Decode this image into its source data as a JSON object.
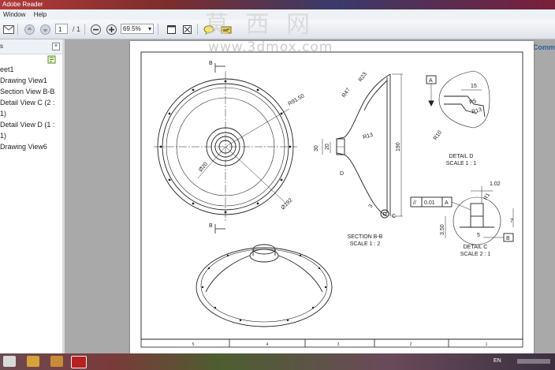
{
  "app": {
    "title": "Adobe Reader"
  },
  "menu": {
    "items": [
      "Window",
      "Help"
    ]
  },
  "toolbar": {
    "page_current": "1",
    "page_total": "/ 1",
    "zoom": "69.5%",
    "comment_label": "Comm"
  },
  "sidebar": {
    "title_fragment": "s",
    "items": [
      "eet1",
      "Drawing View1",
      "Section View B-B",
      "Detail View C (2 :",
      "1)",
      "Detail View D (1 :",
      "1)",
      "Drawing View6"
    ]
  },
  "watermark": {
    "chinese": "莫 西 网",
    "url": "www.3dmox.com"
  },
  "drawing": {
    "section_label_b": "B",
    "dim_r91": "R91.50",
    "dim_d20": "Ø20",
    "dim_d192": "Ø192",
    "dim_r23": "R23",
    "dim_r47": "R47",
    "dim_30": "30",
    "dim_20": "20",
    "dim_r13": "R13",
    "dim_190": "190",
    "dim_3": "3",
    "label_d": "D",
    "label_c": "C",
    "section_title": "SECTION B-B",
    "section_scale": "SCALE 1 : 2",
    "detail_d_a": "A",
    "detail_d_15": "15",
    "detail_d_r5": "R5",
    "detail_d_r13": "R13",
    "detail_d_r10": "R10",
    "detail_d_title": "DETAIL D",
    "detail_d_scale": "SCALE 1 : 1",
    "detail_c_102": "1.02",
    "detail_c_r1": "R1",
    "detail_c_tol_sym": "//",
    "detail_c_tol": "0.01",
    "detail_c_tol_ref": "A",
    "detail_c_350": "3.50",
    "detail_c_7": "7",
    "detail_c_5": "5",
    "detail_c_b": "B",
    "detail_c_title": "DETAIL C",
    "detail_c_scale": "SCALE 2 : 1",
    "zones": [
      "5",
      "4",
      "3",
      "2",
      "1"
    ]
  },
  "taskbar": {
    "lang": "EN"
  }
}
